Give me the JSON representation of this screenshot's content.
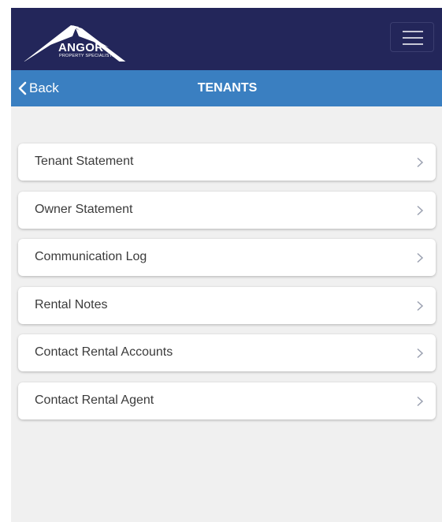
{
  "header": {
    "logo_brand": "ANGOR",
    "logo_tagline": "PROPERTY SPECIALISTS"
  },
  "navbar": {
    "back_label": "Back",
    "title": "TENANTS"
  },
  "menu_items": [
    {
      "label": "Tenant Statement"
    },
    {
      "label": "Owner Statement"
    },
    {
      "label": "Communication Log"
    },
    {
      "label": "Rental Notes"
    },
    {
      "label": "Contact Rental Accounts"
    },
    {
      "label": "Contact Rental Agent"
    }
  ],
  "icons": {
    "menu": "hamburger-icon",
    "back": "chevron-left-icon",
    "item": "chevron-right-icon"
  },
  "colors": {
    "topbar": "#23265a",
    "navbar": "#3a7fc1",
    "page_bg": "#f0f0f0",
    "item_bg": "#ffffff",
    "item_text": "#3b3b3b",
    "chevron": "#9aa0b0"
  }
}
